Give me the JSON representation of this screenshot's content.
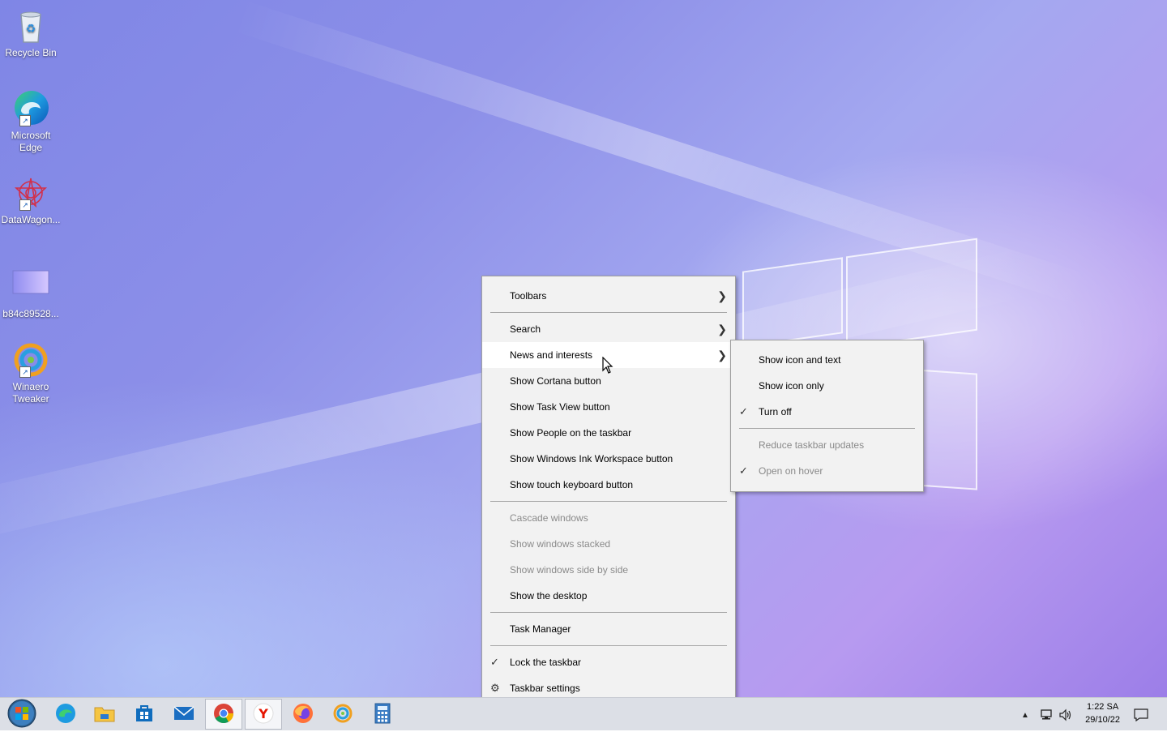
{
  "desktop": {
    "icons": [
      {
        "label": "Recycle Bin",
        "icon": "recycle-bin-icon"
      },
      {
        "label": "Microsoft Edge",
        "icon": "edge-icon"
      },
      {
        "label": "DataWagon...",
        "icon": "datawagon-icon"
      },
      {
        "label": "b84c89528...",
        "icon": "image-file-icon"
      },
      {
        "label": "Winaero Tweaker",
        "icon": "winaero-tweaker-icon"
      }
    ]
  },
  "context_menu": {
    "items": [
      {
        "label": "Toolbars",
        "submenu": true
      },
      {
        "label": "Search",
        "submenu": true
      },
      {
        "label": "News and interests",
        "submenu": true,
        "highlighted": true
      },
      {
        "label": "Show Cortana button"
      },
      {
        "label": "Show Task View button"
      },
      {
        "label": "Show People on the taskbar"
      },
      {
        "label": "Show Windows Ink Workspace button"
      },
      {
        "label": "Show touch keyboard button"
      },
      {
        "label": "Cascade windows",
        "disabled": true
      },
      {
        "label": "Show windows stacked",
        "disabled": true
      },
      {
        "label": "Show windows side by side",
        "disabled": true
      },
      {
        "label": "Show the desktop"
      },
      {
        "label": "Task Manager"
      },
      {
        "label": "Lock the taskbar",
        "checked": true
      },
      {
        "label": "Taskbar settings",
        "icon": "gear-icon"
      }
    ]
  },
  "submenu": {
    "items": [
      {
        "label": "Show icon and text"
      },
      {
        "label": "Show icon only"
      },
      {
        "label": "Turn off",
        "checked": true
      },
      {
        "label": "Reduce taskbar updates",
        "disabled": true
      },
      {
        "label": "Open on hover",
        "checked": true,
        "disabled": true
      }
    ]
  },
  "taskbar": {
    "apps": [
      {
        "name": "start-button",
        "icon": "windows-orb-icon"
      },
      {
        "name": "edge",
        "icon": "edge-icon"
      },
      {
        "name": "file-explorer",
        "icon": "folder-icon"
      },
      {
        "name": "store",
        "icon": "store-icon"
      },
      {
        "name": "mail",
        "icon": "mail-icon"
      },
      {
        "name": "chrome",
        "icon": "chrome-icon",
        "active": true
      },
      {
        "name": "yandex",
        "icon": "yandex-icon",
        "active": true
      },
      {
        "name": "firefox",
        "icon": "firefox-icon"
      },
      {
        "name": "winaero",
        "icon": "winaero-icon"
      },
      {
        "name": "calculator",
        "icon": "calculator-icon"
      }
    ],
    "tray": {
      "time": "1:22 SA",
      "date": "29/10/22"
    }
  },
  "colors": {
    "menu_bg": "#f2f2f2",
    "menu_hover": "#ffffff",
    "disabled_text": "#8a8a8a",
    "taskbar_bg": "#dcdfe6"
  }
}
